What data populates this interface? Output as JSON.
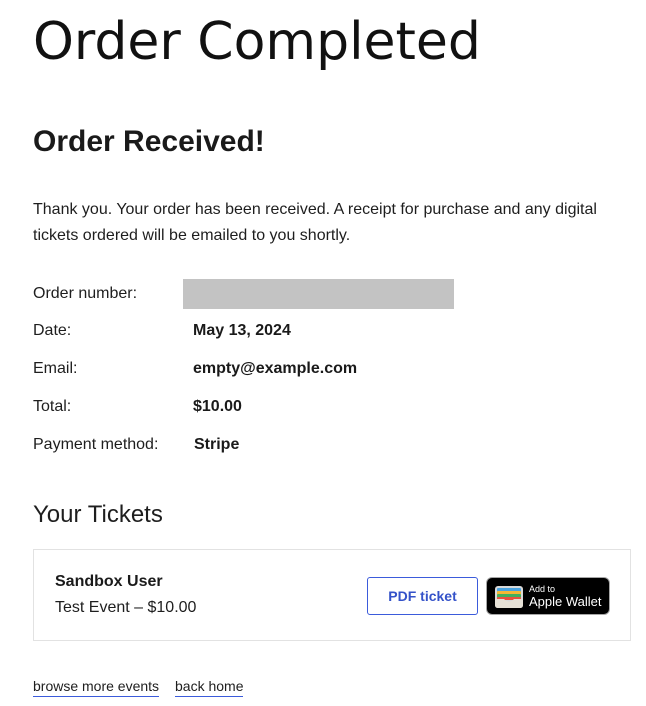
{
  "page": {
    "title": "Order Completed"
  },
  "order": {
    "heading": "Order Received!",
    "message": "Thank you. Your order has been received. A receipt for purchase and any digital tickets ordered will be emailed to you shortly.",
    "details": {
      "order_number_label": "Order number:",
      "date_label": "Date:",
      "date_value": "May 13, 2024",
      "email_label": "Email:",
      "email_value": "empty@example.com",
      "total_label": "Total:",
      "total_value": "$10.00",
      "payment_label": "Payment method:",
      "payment_value": "Stripe"
    }
  },
  "tickets": {
    "heading": "Your Tickets",
    "items": [
      {
        "holder": "Sandbox User",
        "event": "Test Event – $10.00",
        "pdf_button_label": "PDF ticket",
        "wallet_small_label": "Add to",
        "wallet_large_label": "Apple Wallet",
        "wallet_icon": "wallet-icon"
      }
    ]
  },
  "footer": {
    "browse_link": "browse more events",
    "home_link": "back home"
  },
  "colors": {
    "accent": "#3b5bdb",
    "redaction": "#c3c3c3",
    "wallet_bg": "#000000"
  }
}
